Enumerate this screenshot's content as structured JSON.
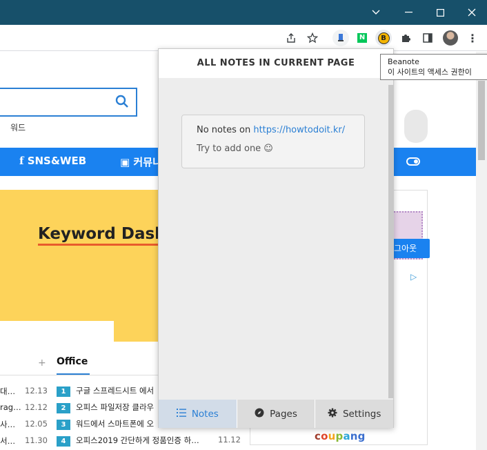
{
  "window": {
    "minimize": "⌄",
    "min2": "—",
    "maximize": "▢",
    "close": "✕"
  },
  "toolbar": {
    "icons": [
      "share-icon",
      "star-icon",
      "extension-icon",
      "naver-icon",
      "beanote-icon",
      "puzzle-icon",
      "sidepanel-icon",
      "avatar",
      "menu-icon"
    ],
    "beanote_letter": "B",
    "naver_letter": "N",
    "menu": "⋮"
  },
  "tooltip": {
    "title": "Beanote",
    "text": "이 사이트의 액세스 권한이"
  },
  "site": {
    "tag": "워드",
    "nav": [
      "SNS&WEB",
      "커뮤니"
    ],
    "banner_title": "Keyword Dashbo",
    "plus": "+",
    "office_tab": "Office",
    "left_items": [
      {
        "text": "대…",
        "date": "12.13"
      },
      {
        "text": "rag…",
        "date": "12.12"
      },
      {
        "text": "사…",
        "date": "12.05"
      },
      {
        "text": "서…",
        "date": "11.30"
      }
    ],
    "office_items": [
      {
        "num": "1",
        "text": "구글 스프레드시트 에서",
        "date": ""
      },
      {
        "num": "2",
        "text": "오피스 파일저장 클라우",
        "date": ""
      },
      {
        "num": "3",
        "text": "워드에서 스마트폰에 오",
        "date": ""
      },
      {
        "num": "4",
        "text": "오피스2019 간단하게 정품인증 하…",
        "date": "11.12"
      }
    ],
    "ad_button": "그아웃",
    "coupang": "coupang"
  },
  "popup": {
    "header": "ALL NOTES IN CURRENT PAGE",
    "empty_prefix": "No notes on ",
    "empty_url": "https://howtodoit.kr/",
    "empty_hint": "Try to add one ☺",
    "footer": {
      "notes": "Notes",
      "pages": "Pages",
      "settings": "Settings"
    }
  },
  "colors": {
    "titlebar": "#17506a",
    "accent": "#2a7fd4",
    "navbar": "#1a82f0",
    "banner": "#fdd35a"
  }
}
